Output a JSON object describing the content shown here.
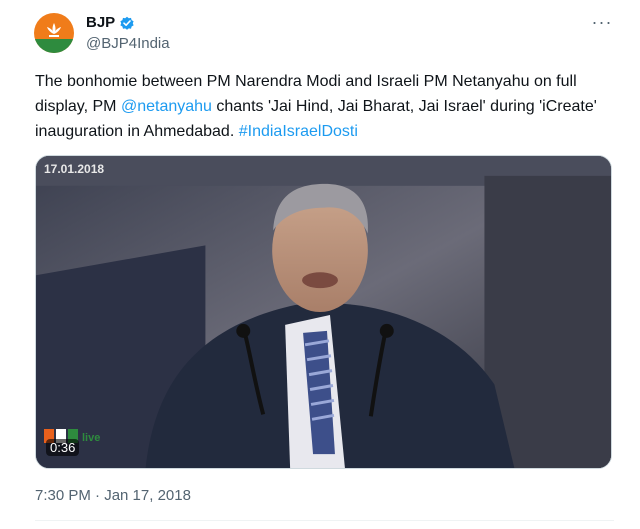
{
  "author": {
    "display_name": "BJP",
    "handle": "@BJP4India",
    "avatar_colors": {
      "top": "#f07c1a",
      "bottom": "#2e8b3e"
    },
    "verified_color": "#1d9bf0"
  },
  "menu_icon": "more-horizontal-icon",
  "menu_glyph": "···",
  "tweet": {
    "text_before_mention": "The bonhomie between PM Narendra Modi and Israeli PM Netanyahu on full display, PM ",
    "mention": "@netanyahu",
    "text_after_mention": " chants 'Jai Hind, Jai Bharat, Jai Israel' during 'iCreate' inauguration in Ahmedabad. ",
    "hashtag": "#IndiaIsraelDosti",
    "link_color": "#1d9bf0"
  },
  "video": {
    "date_overlay": "17.01.2018",
    "duration": "0:36",
    "channel_logo": "RR live"
  },
  "meta": {
    "timestamp": "7:30 PM · Jan 17, 2018"
  }
}
